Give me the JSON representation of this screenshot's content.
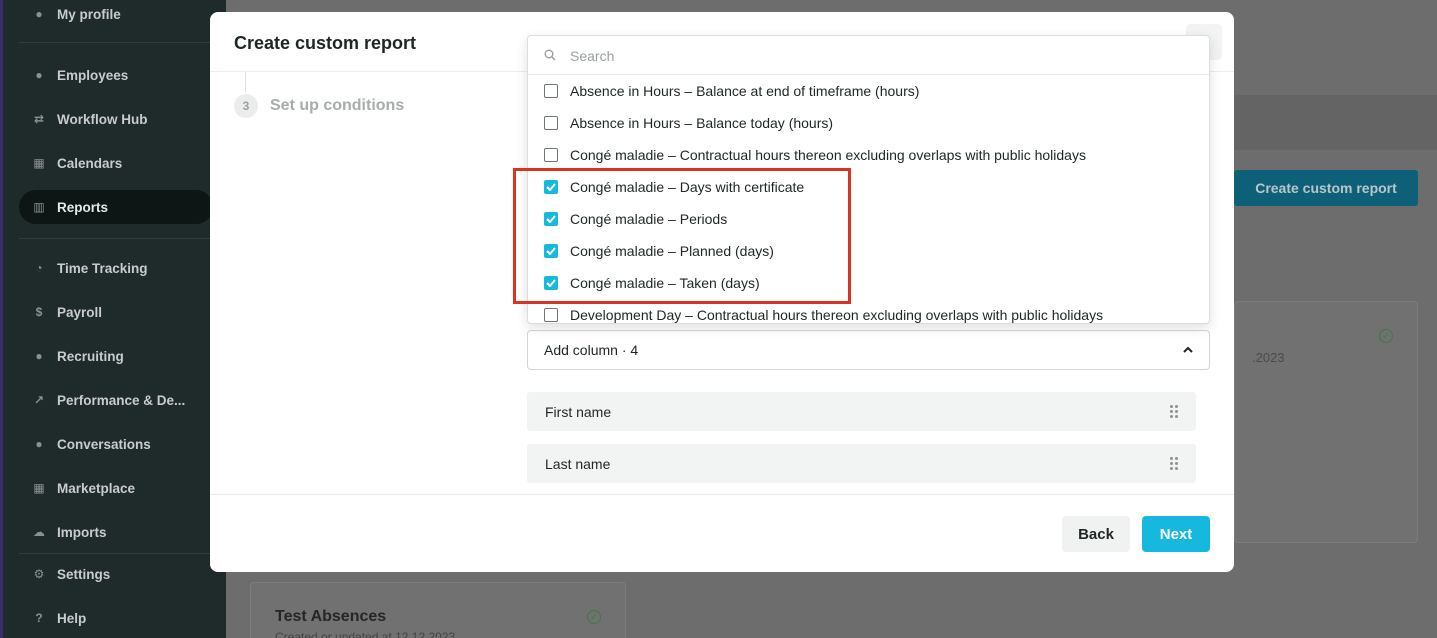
{
  "sidebar": {
    "items": [
      {
        "label": "My profile",
        "icon": "user-icon",
        "glyph": "●"
      },
      {
        "label": "Employees",
        "icon": "users-icon",
        "glyph": "●"
      },
      {
        "label": "Workflow Hub",
        "icon": "workflow-icon",
        "glyph": "⇄"
      },
      {
        "label": "Calendars",
        "icon": "calendar-icon",
        "glyph": "▦"
      },
      {
        "label": "Reports",
        "icon": "chart-icon",
        "glyph": "▥"
      },
      {
        "label": "Time Tracking",
        "icon": "clock-icon",
        "glyph": "◔"
      },
      {
        "label": "Payroll",
        "icon": "dollar-icon",
        "glyph": "$"
      },
      {
        "label": "Recruiting",
        "icon": "handshake-icon",
        "glyph": "●"
      },
      {
        "label": "Performance & De...",
        "icon": "trend-icon",
        "glyph": "↗"
      },
      {
        "label": "Conversations",
        "icon": "chat-icon",
        "glyph": "●"
      },
      {
        "label": "Marketplace",
        "icon": "grid-icon",
        "glyph": "▦"
      },
      {
        "label": "Imports",
        "icon": "cloud-upload-icon",
        "glyph": "☁"
      },
      {
        "label": "Settings",
        "icon": "gear-icon",
        "glyph": "⚙"
      },
      {
        "label": "Help",
        "icon": "question-icon",
        "glyph": "?"
      }
    ]
  },
  "background": {
    "create_button": "Create custom report",
    "card_date": ".2023",
    "card2_title": "Test Absences",
    "card2_sub": "Created or updated at 12.12.2023"
  },
  "modal": {
    "title": "Create custom report",
    "step": {
      "number": "3",
      "label": "Set up conditions"
    },
    "add_column_label": "Add column · 4",
    "columns": [
      "First name",
      "Last name"
    ],
    "back_label": "Back",
    "next_label": "Next"
  },
  "dropdown": {
    "search_placeholder": "Search",
    "items": [
      {
        "label": "Absence in Hours – Balance at end of timeframe (hours)",
        "checked": false
      },
      {
        "label": "Absence in Hours – Balance today (hours)",
        "checked": false
      },
      {
        "label": "Congé maladie – Contractual hours thereon excluding overlaps with public holidays",
        "checked": false
      },
      {
        "label": "Congé maladie – Days with certificate",
        "checked": true
      },
      {
        "label": "Congé maladie – Periods",
        "checked": true
      },
      {
        "label": "Congé maladie – Planned (days)",
        "checked": true
      },
      {
        "label": "Congé maladie – Taken (days)",
        "checked": true
      },
      {
        "label": "Development Day – Contractual hours thereon excluding overlaps with public holidays",
        "checked": false
      }
    ]
  },
  "colors": {
    "accent": "#16b8de",
    "highlight": "#d8341f",
    "sidebar_bg": "#1f2a2a"
  }
}
